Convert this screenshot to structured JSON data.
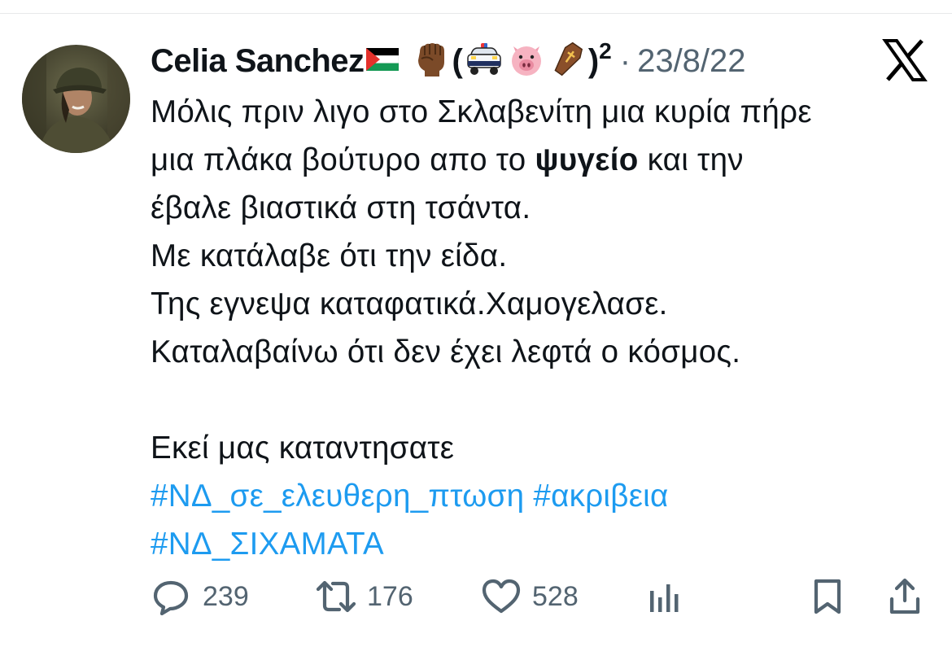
{
  "tweet": {
    "author": {
      "name": "Celia Sanchez",
      "flag_icon": "palestine-flag-icon",
      "name_suffix_icons": [
        "raised-fist-icon",
        "police-car-icon",
        "pig-face-icon",
        "coffin-icon"
      ],
      "paren_open": "(",
      "paren_close": ")",
      "superscript": "2"
    },
    "separator": "·",
    "date": "23/8/22",
    "platform_icon": "x-logo-icon",
    "text_lines": [
      "Μόλις πριν λιγο στο Σκλαβενίτη μια κυρία πήρε",
      "μια πλάκα βούτυρο απο το ",
      "ψυγείο",
      " και την",
      "έβαλε βιαστικά στη τσάντα.",
      "Με κατάλαβε ότι την είδα.",
      "Της εγνεψα καταφατικά.Χαμογελασε.",
      "Καταλαβαίνω ότι δεν έχει λεφτά ο κόσμος.",
      "Εκεί μας καταντησατε"
    ],
    "hashtags": [
      "#ΝΔ_σε_ελευθερη_πτωση",
      "#ακριβεια",
      "#ΝΔ_ΣΙΧΑΜΑΤΑ"
    ],
    "stats": {
      "replies": "239",
      "reposts": "176",
      "likes": "528"
    },
    "colors": {
      "text": "#0f1419",
      "secondary": "#536471",
      "hashtag": "#1d9bf0"
    }
  }
}
